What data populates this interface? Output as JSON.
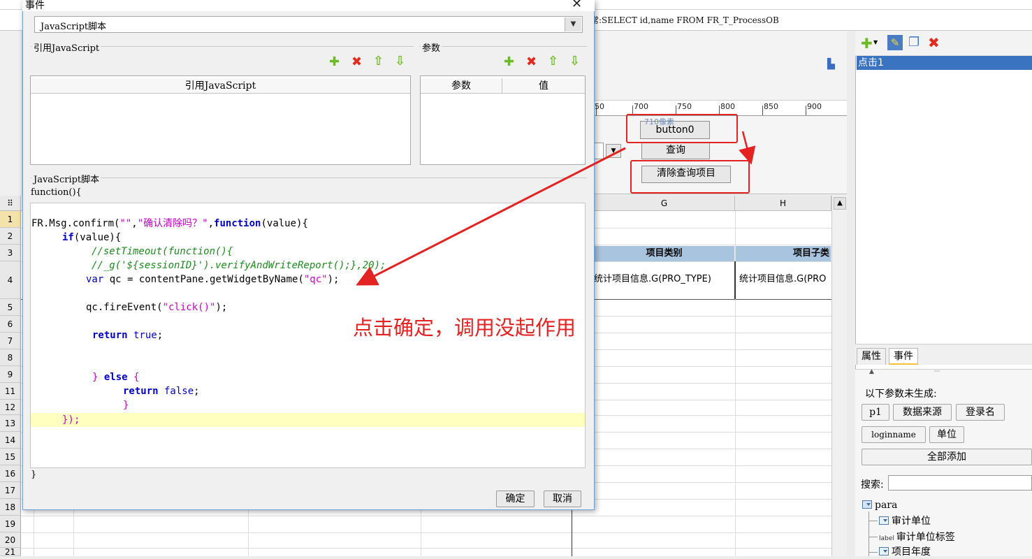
{
  "background": {
    "sql_text": "常:SELECT id,name FROM FR_T_ProcessOB",
    "ruler_ticks": [
      "50",
      "700",
      "750",
      "800",
      "850",
      "900"
    ],
    "widgets": {
      "button0_label": "button0",
      "width_hint": "710像素",
      "query_label": "查询",
      "clear_label": "清除查询项目"
    },
    "columns": [
      "G",
      "H"
    ],
    "rows": [
      "1",
      "2",
      "3",
      "4",
      "5",
      "6",
      "7",
      "8",
      "9",
      "11",
      "12",
      "13",
      "14",
      "15",
      "16",
      "17",
      "18",
      "19",
      "20",
      "21"
    ],
    "header_cells": [
      "项目类别",
      "项目子类"
    ],
    "data_cells": [
      "统计项目信息.G(PRO_TYPE)",
      "统计项目信息.G(PRO"
    ]
  },
  "right_panel": {
    "selected_item": "点击1",
    "tabs": [
      "属性",
      "事件"
    ],
    "active_tab": "事件",
    "params_note": "以下参数未生成:",
    "param_buttons": [
      "p1",
      "数据来源",
      "登录名",
      "loginname",
      "单位"
    ],
    "add_all": "全部添加",
    "search_label": "搜索:",
    "tree": [
      "para",
      "审计单位",
      "审计单位标签",
      "项目年度"
    ],
    "label_tag": "label"
  },
  "dialog": {
    "title": "事件",
    "type_value": "JavaScript脚本",
    "ref_group_label": "引用JavaScript",
    "ref_table_header": "引用JavaScript",
    "param_group_label": "参数",
    "param_col_name": "参数",
    "param_col_value": "值",
    "script_group_label": "JavaScript脚本",
    "fn_open": "function(){",
    "fn_close": "}",
    "code": {
      "l1_a": "FR.Msg.confirm(",
      "l1_b": "\"\"",
      "l1_c": ",",
      "l1_d": "\"确认清除吗？\"",
      "l1_e": ",",
      "l1_f": "function",
      "l1_g": "(value){",
      "l2_a": "if",
      "l2_b": "(value){",
      "l3": "//setTimeout(function(){",
      "l4": "//_g('${sessionID}').verifyAndWriteReport();},20);",
      "l5_a": "var",
      "l5_b": " qc = contentPane.getWidgetByName(",
      "l5_c": "\"qc\"",
      "l5_d": ");",
      "l6_a": "qc.fireEvent(",
      "l6_b": "\"click()\"",
      "l6_c": ");",
      "l7_a": "return",
      "l7_b": " true",
      "l7_c": ";",
      "l8_a": "} ",
      "l8_b": "else",
      "l8_c": " {",
      "l9_a": "return",
      "l9_b": " false",
      "l9_c": ";",
      "l10": "}",
      "l11": "});"
    },
    "ok_label": "确定",
    "cancel_label": "取消"
  },
  "annotation": "点击确定，调用没起作用",
  "colors": {
    "annotation_red": "#e32222",
    "selection_blue": "#3a73c0",
    "highlight_line": "#ffffc0"
  },
  "icons": [
    "close-icon",
    "dropdown-arrow-icon",
    "add-icon",
    "delete-icon",
    "move-up-icon",
    "move-down-icon",
    "edit-icon",
    "copy-icon"
  ]
}
